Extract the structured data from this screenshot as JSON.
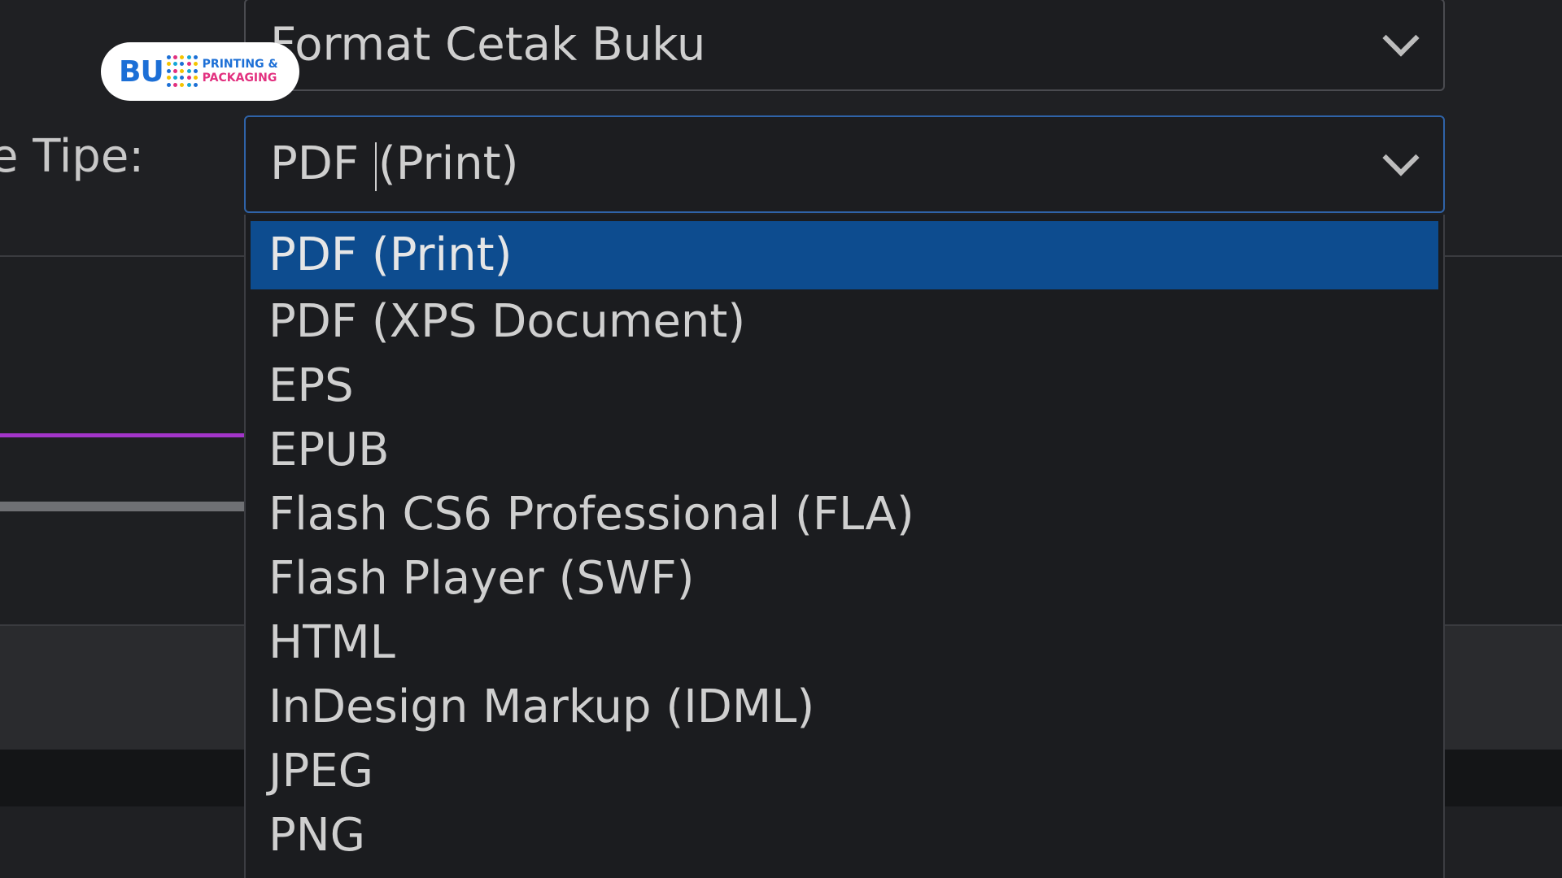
{
  "logo": {
    "mark": "BU",
    "line1": "PRINTING &",
    "line2": "PACKAGING",
    "colors": {
      "primary": "#1c6fd6",
      "accent": "#e2307f",
      "dots": [
        "#1c6fd6",
        "#e2307f",
        "#f5c400",
        "#14a7d6"
      ]
    }
  },
  "preset_select": {
    "value": "Format Cetak Buku"
  },
  "type_field": {
    "label": "e Tipe:",
    "value": "PDF (Print)"
  },
  "dropdown": {
    "selected_index": 0,
    "options": [
      "PDF (Print)",
      "PDF (XPS Document)",
      "EPS",
      "EPUB",
      "Flash CS6 Professional (FLA)",
      "Flash Player (SWF)",
      "HTML",
      "InDesign Markup (IDML)",
      "JPEG",
      "PNG"
    ]
  },
  "theme": {
    "highlight": "#0d4c8f",
    "focus_border": "#2f63a8",
    "purple_line": "#a335c9"
  }
}
